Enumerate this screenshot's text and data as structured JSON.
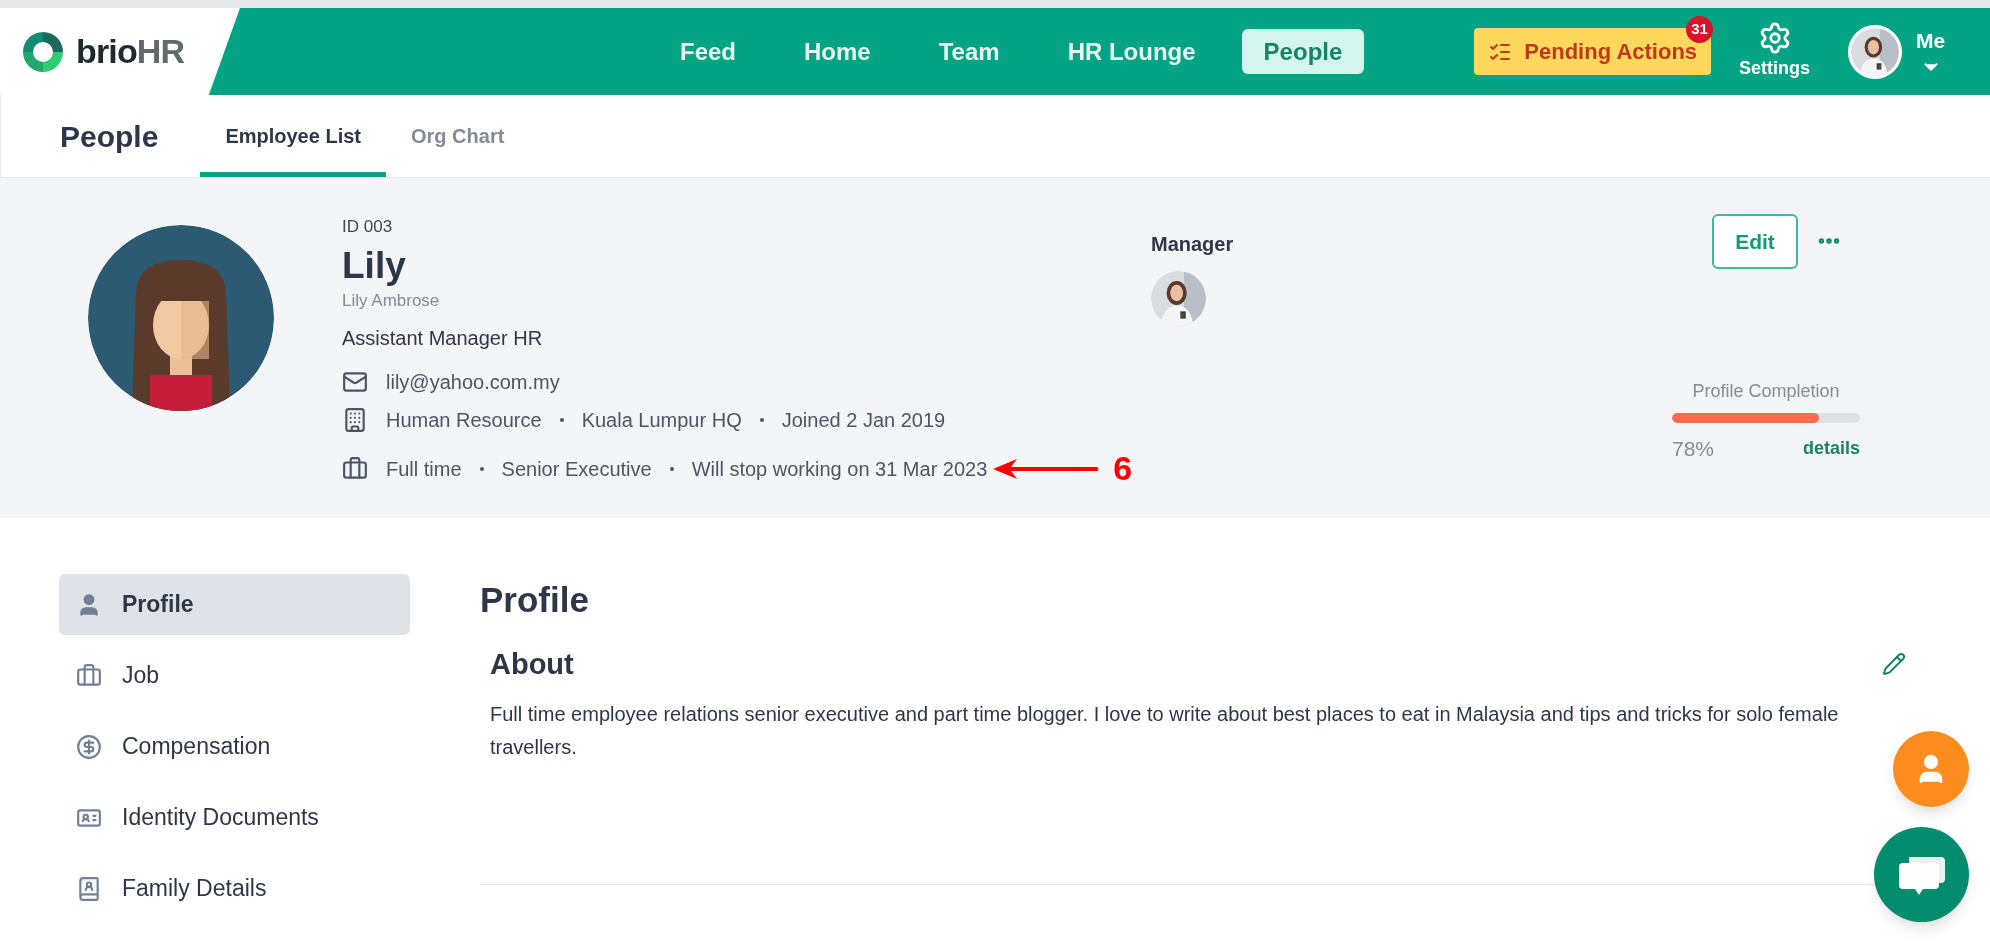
{
  "top_bar": {
    "logo": {
      "word": "brio",
      "suffix": "HR"
    },
    "nav": [
      {
        "label": "Feed",
        "selected": false
      },
      {
        "label": "Home",
        "selected": false
      },
      {
        "label": "Team",
        "selected": false
      },
      {
        "label": "HR Lounge",
        "selected": false
      },
      {
        "label": "People",
        "selected": true
      }
    ],
    "pending_actions": {
      "label": "Pending Actions",
      "badge": "31"
    },
    "settings": "Settings",
    "user": "Me"
  },
  "sub_header": {
    "title": "People",
    "tabs": [
      {
        "label": "Employee List",
        "selected": true
      },
      {
        "label": "Org Chart",
        "selected": false
      }
    ]
  },
  "employee": {
    "id": "ID 003",
    "name": "Lily",
    "full_name": "Lily Ambrose",
    "position": "Assistant Manager HR",
    "email": "lily@yahoo.com.my",
    "org": [
      "Human Resource",
      "Kuala Lumpur HQ",
      "Joined 2 Jan 2019"
    ],
    "job": [
      "Full time",
      "Senior Executive",
      "Will stop working on 31 Mar 2023"
    ],
    "manager_label": "Manager",
    "edit": "Edit",
    "completion": {
      "label": "Profile Completion",
      "level": 0.78,
      "reading": "78%",
      "link": "details"
    }
  },
  "annotation": {
    "label": "6"
  },
  "sidebar": [
    {
      "label": "Profile",
      "selected": true
    },
    {
      "label": "Job",
      "selected": false
    },
    {
      "label": "Compensation",
      "selected": false
    },
    {
      "label": "Identity Documents",
      "selected": false
    },
    {
      "label": "Family Details",
      "selected": false
    }
  ],
  "content": {
    "title": "Profile",
    "about": {
      "heading": "About",
      "text": "Full time employee relations senior executive and part time blogger. I love to write about best places to eat in Malaysia and tips and tricks for solo female travellers."
    }
  }
}
